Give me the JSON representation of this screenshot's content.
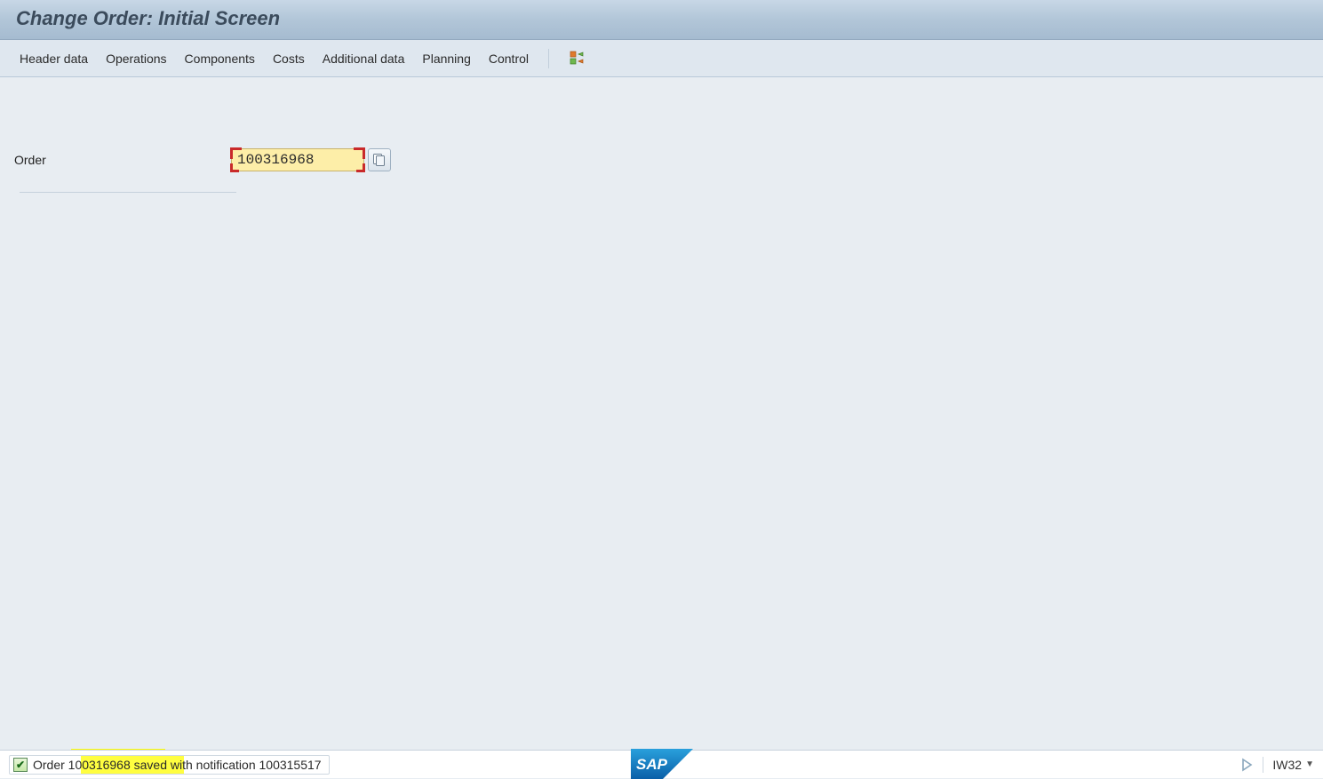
{
  "title": "Change Order: Initial Screen",
  "toolbar": {
    "items": [
      "Header data",
      "Operations",
      "Components",
      "Costs",
      "Additional data",
      "Planning",
      "Control"
    ]
  },
  "form": {
    "order_label": "Order",
    "order_value": "100316968"
  },
  "status": {
    "message": "Order 100316968 saved with notification 100315517"
  },
  "footer": {
    "transaction_code": "IW32"
  }
}
